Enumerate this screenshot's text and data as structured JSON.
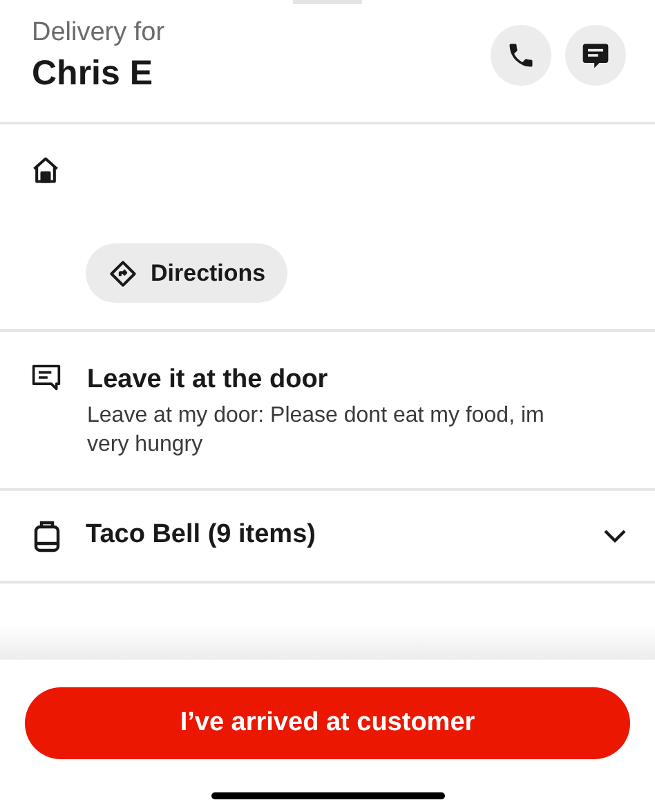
{
  "header": {
    "subtitle": "Delivery for",
    "customer_name": "Chris E"
  },
  "directions_button": {
    "label": "Directions"
  },
  "instructions": {
    "title": "Leave it at the door",
    "note": "Leave at my door: Please dont eat my food, im very hungry"
  },
  "order": {
    "label": "Taco Bell (9 items)",
    "expanded": false
  },
  "primary_button": {
    "label": "I’ve arrived at customer"
  }
}
